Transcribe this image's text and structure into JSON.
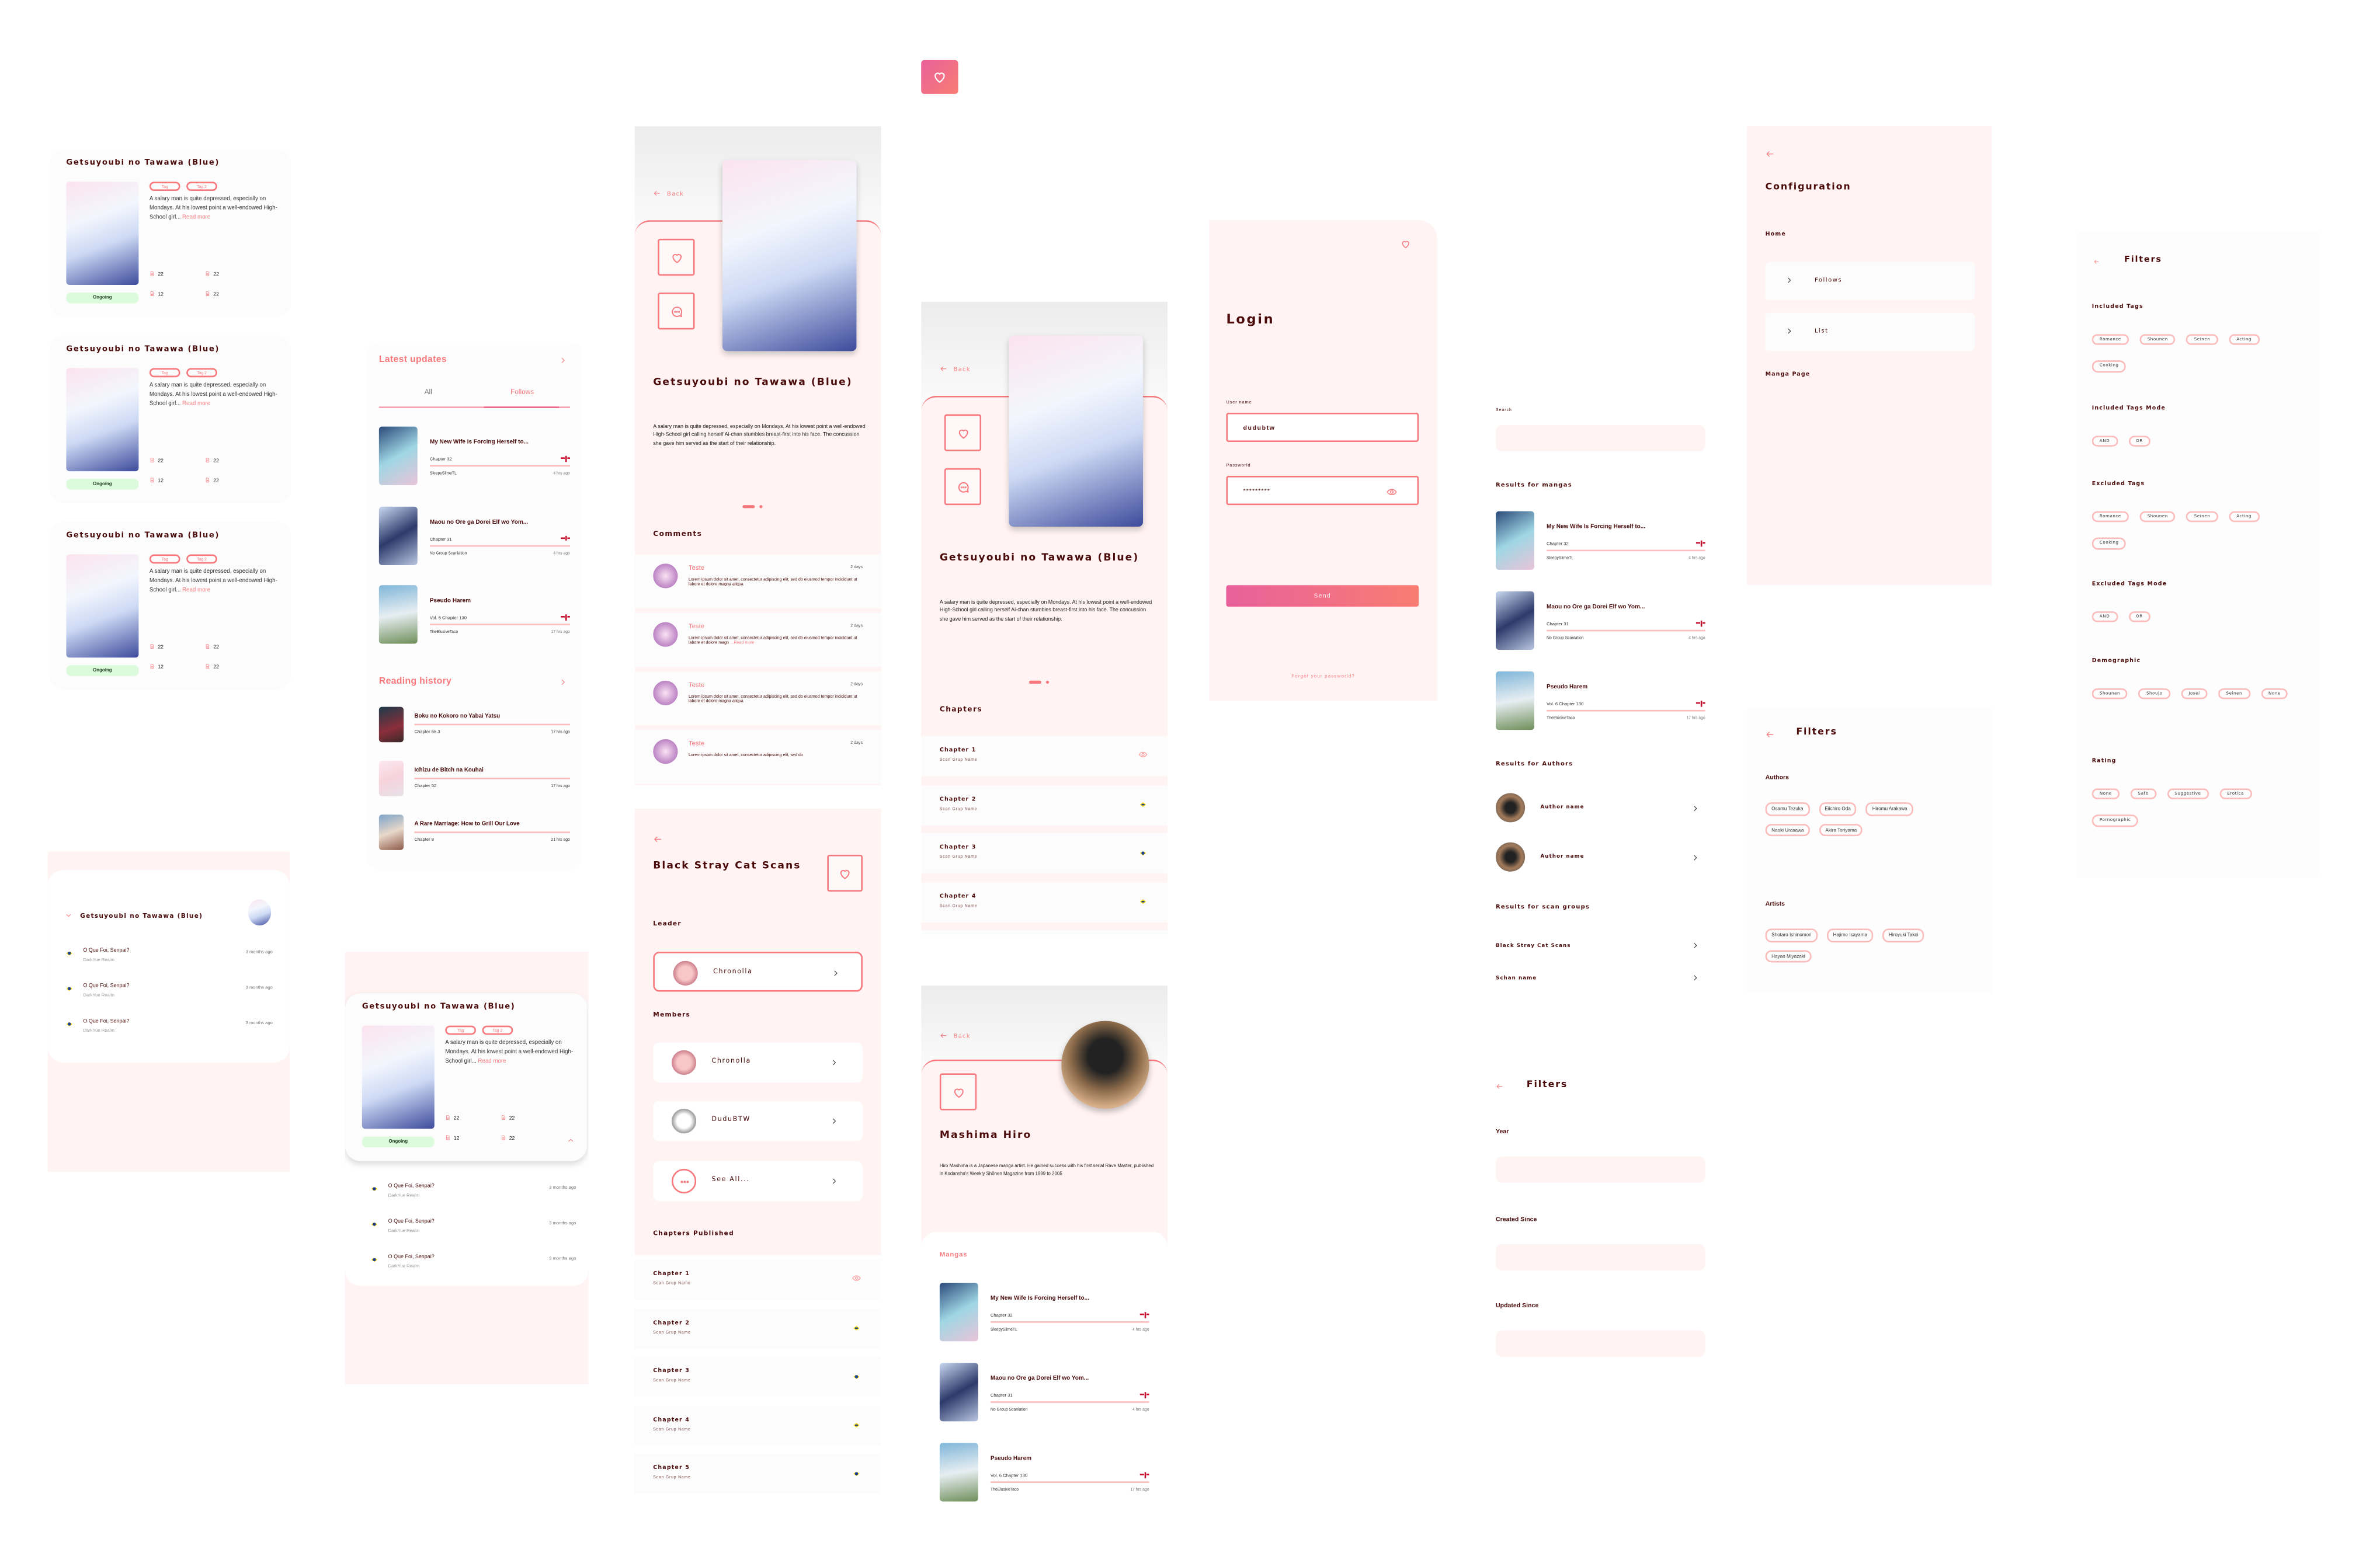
{
  "colors": {
    "accent": "#f7797d",
    "text_dark": "#4a0a0a",
    "pink_bg": "#fff3f3",
    "status_green": "#dcfadc",
    "gradient_start": "#e9609b",
    "gradient_end": "#fa7c72"
  },
  "logo": {
    "icon": "heart-icon"
  },
  "manga": {
    "title": "Getsuyoubi no Tawawa (Blue)",
    "tags": [
      "Tag",
      "Tag 2"
    ],
    "summary_short": "A salary man is quite depressed, especially on Mondays. At his lowest point a well-endowed High-School girl...",
    "read_more": "Read more",
    "stats": [
      "22",
      "22",
      "12",
      "22"
    ],
    "status": "Ongoing",
    "summary": "A salary man is quite depressed, especially on Mondays. At his lowest point a well-endowed High-School girl calling herself Ai-chan stumbles breast-first into his face. The concussion she gave him served as the start of their relationship."
  },
  "manga_list": [
    {
      "title": "My New Wife Is Forcing Herself to...",
      "chapter": "Chapter 32",
      "group": "SleepySlimeTL",
      "time": "4 hrs ago",
      "flag": "uk"
    },
    {
      "title": "Maou no Ore ga Dorei Elf wo Yom...",
      "chapter": "Chapter 31",
      "group": "No Group Scanlation",
      "time": "4 hrs ago",
      "flag": "uk"
    },
    {
      "title": "Pseudo Harem",
      "chapter": "Vol. 6 Chapter 130",
      "group": "TheElusiveTaco",
      "time": "17 hrs ago",
      "flag": "uk"
    }
  ],
  "home": {
    "latest_title": "Latest updates",
    "tabs": [
      "All",
      "Follows"
    ],
    "active_tab": "Follows",
    "history_title": "Reading history",
    "history": [
      {
        "title": "Boku no Kokoro no Yabai Yatsu",
        "chapter": "Chapter 65.3",
        "time": "17 hrs ago"
      },
      {
        "title": "Ichizu de Bitch na Kouhai",
        "chapter": "Chapter 52",
        "time": "17 hrs ago"
      },
      {
        "title": "A Rare Marriage: How to Grill Our Love",
        "chapter": "Chapter 8",
        "time": "21 hrs ago"
      }
    ]
  },
  "chapter_feed": [
    {
      "title": "O Que Foi, Senpai?",
      "group": "DarkYue Realm",
      "time": "3 months ago",
      "flag": "br"
    },
    {
      "title": "O Que Foi, Senpai?",
      "group": "DarkYue Realm",
      "time": "3 months ago",
      "flag": "br"
    },
    {
      "title": "O Que Foi, Senpai?",
      "group": "DarkYue Realm",
      "time": "3 months ago",
      "flag": "br"
    }
  ],
  "detail": {
    "back": "Back",
    "comments_title": "Comments",
    "comments": [
      {
        "name": "Teste",
        "time": "2 days",
        "text": "Lorem ipsum dolor sit amet, consectetur adipiscing elit, sed do eiusmod tempor incididunt ut labore et dolore magna aliqua",
        "more": ""
      },
      {
        "name": "Teste",
        "time": "2 days",
        "text": "Lorem ipsum dolor sit amet, consectetur adipiscing elit, sed do eiusmod tempor incididunt ut labore et dolore magn",
        "more": "...Read more"
      },
      {
        "name": "Teste",
        "time": "2 days",
        "text": "Lorem ipsum dolor sit amet, consectetur adipiscing elit, sed do eiusmod tempor incididunt ut labore et dolore magna aliqua",
        "more": ""
      },
      {
        "name": "Teste",
        "time": "2 days",
        "text": "Lorem ipsum dolor sit amet, consectetur adipiscing elit, sed do",
        "more": ""
      }
    ],
    "chapters_title": "Chapters"
  },
  "chapters": [
    {
      "title": "Chapter 1",
      "group": "Scan Grup Name",
      "state": "read"
    },
    {
      "title": "Chapter 2",
      "group": "Scan Grup Name",
      "state": "br"
    },
    {
      "title": "Chapter 3",
      "group": "Scan Grup Name",
      "state": "br"
    },
    {
      "title": "Chapter 4",
      "group": "Scan Grup Name",
      "state": "br"
    },
    {
      "title": "Chapter 5",
      "group": "Scan Grup Name",
      "state": "br"
    }
  ],
  "login": {
    "title": "Login",
    "username_label": "User name",
    "username_value": "dudubtw",
    "password_label": "Passworld",
    "password_value": "*********",
    "send": "Send",
    "forgot": "Forgot your passworld?"
  },
  "scan_group": {
    "name": "Black Stray Cat Scans",
    "leader_label": "Leader",
    "leader": "Chronolla",
    "members_label": "Members",
    "members": [
      "Chronolla",
      "DuduBTW",
      "See All..."
    ],
    "chapters_label": "Chapters Published"
  },
  "author": {
    "back": "Back",
    "name": "Mashima Hiro",
    "bio": "Hiro Mashima is a Japanese manga artist. He gained success with his first serial Rave Master, published in Kodansha's Weekly Shōnen Magazine from 1999 to 2005",
    "mangas_label": "Mangas"
  },
  "search": {
    "label": "Search",
    "value": "",
    "mangas_label": "Results for mangas",
    "authors_label": "Results for Authors",
    "authors": [
      "Author name",
      "Author name"
    ],
    "groups_label": "Results for scan groups",
    "groups": [
      "Black Stray Cat Scans",
      "Schan name"
    ]
  },
  "filters_dates": {
    "title": "Filters",
    "fields": [
      {
        "label": "Year",
        "value": ""
      },
      {
        "label": "Created Since",
        "value": ""
      },
      {
        "label": "Updated Since",
        "value": ""
      }
    ]
  },
  "configuration": {
    "title": "Configuration",
    "home_label": "Home",
    "items": [
      "Follows",
      "List"
    ],
    "manga_page_label": "Manga Page"
  },
  "filters_people": {
    "title": "Filters",
    "sections": [
      {
        "label": "Authors",
        "chips": [
          "Osamu Tezuka",
          "Eiichiro Oda",
          "Hiromu Arakawa",
          "Naoki Urasawa",
          "Akira Toriyama"
        ]
      },
      {
        "label": "Artists",
        "chips": [
          "Shotaro Ishinomori",
          "Hajime Isayama",
          "Hiroyuki Takei",
          "Hayao Miyazaki"
        ]
      }
    ]
  },
  "filters_tags": {
    "title": "Filters",
    "sections": [
      {
        "label": "Included Tags",
        "chips": [
          "Romance",
          "Shounen",
          "Seinen",
          "Acting",
          "Cooking"
        ]
      },
      {
        "label": "Included Tags Mode",
        "chips": [
          "AND",
          "OR"
        ]
      },
      {
        "label": "Excluded Tags",
        "chips": [
          "Romance",
          "Shounen",
          "Seinen",
          "Acting",
          "Cooking"
        ]
      },
      {
        "label": "Excluded Tags Mode",
        "chips": [
          "AND",
          "OR"
        ]
      },
      {
        "label": "Demographic",
        "chips": [
          "Shounen",
          "Shoujo",
          "Josei",
          "Seinen",
          "None"
        ]
      },
      {
        "label": "Rating",
        "chips": [
          "None",
          "Safe",
          "Suggestive",
          "Erotica",
          "Pornographic"
        ]
      }
    ]
  }
}
